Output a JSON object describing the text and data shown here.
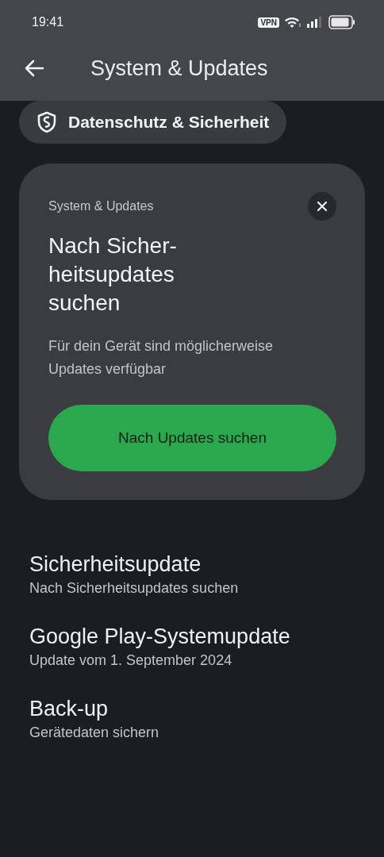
{
  "status_bar": {
    "time": "19:41",
    "vpn": "VPN"
  },
  "app_bar": {
    "title": "System & Updates"
  },
  "chip": {
    "label": "Datenschutz & Sicherheit"
  },
  "card": {
    "overline": "System & Updates",
    "title": "Nach Sicher-\nheitsupdates\nsuchen",
    "body": "Für dein Gerät sind möglicherweise Updates verfügbar",
    "button": "Nach Updates suchen"
  },
  "items": [
    {
      "title": "Sicherheitsupdate",
      "subtitle": "Nach Sicherheitsupdates suchen"
    },
    {
      "title": "Google Play-Systemupdate",
      "subtitle": "Update vom 1. September 2024"
    },
    {
      "title": "Back-up",
      "subtitle": "Gerätedaten sichern"
    }
  ]
}
